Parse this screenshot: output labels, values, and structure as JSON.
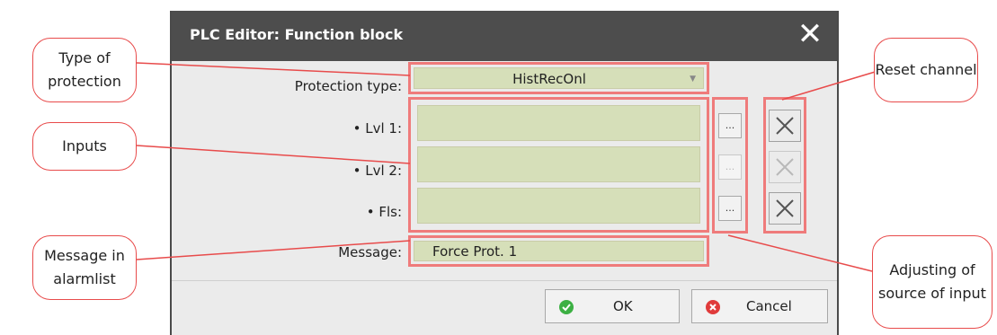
{
  "dialog": {
    "title": "PLC Editor: Function block",
    "close_icon": "close-icon",
    "protection_type_label": "Protection type:",
    "protection_type_value": "HistRecOnl",
    "inputs": [
      {
        "label": "• Lvl 1:",
        "value": "",
        "dots": "...",
        "dots_enabled": true,
        "reset_enabled": true
      },
      {
        "label": "• Lvl 2:",
        "value": "",
        "dots": "...",
        "dots_enabled": false,
        "reset_enabled": false
      },
      {
        "label": "• Fls:",
        "value": "",
        "dots": "...",
        "dots_enabled": true,
        "reset_enabled": true
      }
    ],
    "message_label": "Message:",
    "message_value": "Force Prot. 1",
    "ok_label": "OK",
    "cancel_label": "Cancel"
  },
  "callouts": {
    "type_of_protection": "Type of protection",
    "inputs": "Inputs",
    "message_in_alarmlist": "Message in alarmlist",
    "reset_channel": "Reset channel",
    "adjusting_source": "Adjusting of source of input"
  },
  "colors": {
    "titlebar": "#4d4d4d",
    "field": "#d6dfb9",
    "highlight": "#ef7b7b",
    "callout_border": "#e84b4b",
    "ok_icon": "#3cb043",
    "cancel_icon": "#e03b3b"
  }
}
